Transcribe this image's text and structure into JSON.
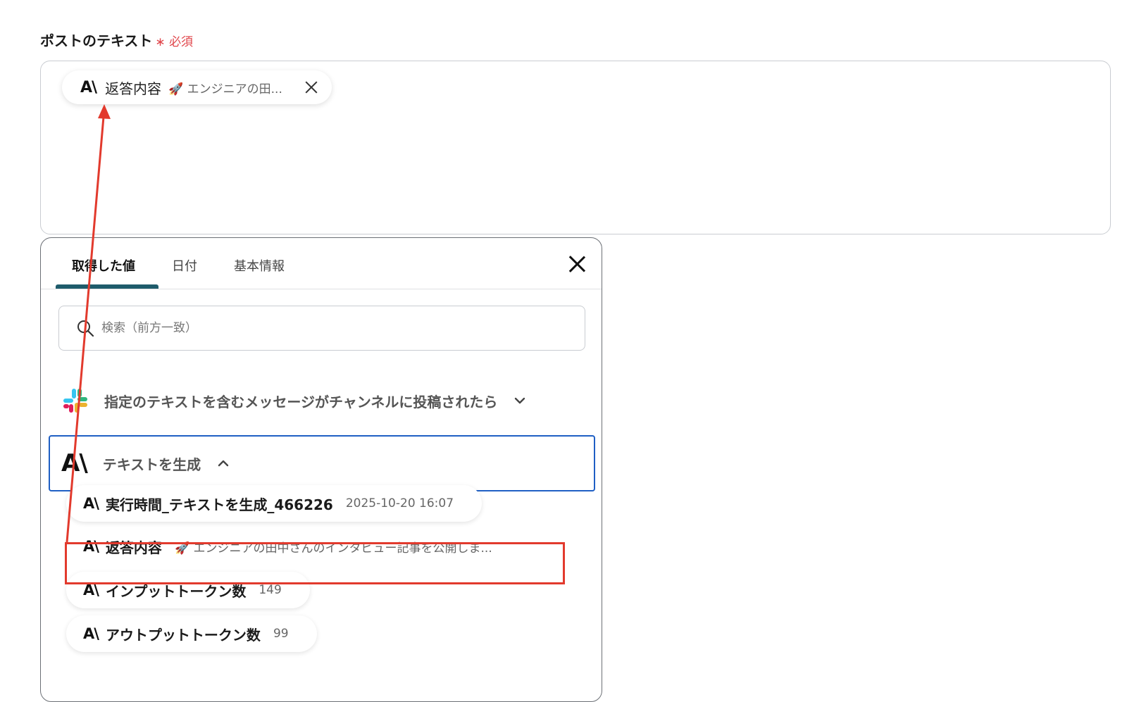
{
  "field": {
    "label": "ポストのテキスト",
    "required_mark": "∗",
    "required_text": "必須"
  },
  "chip": {
    "logo": "A\\",
    "label": "返答内容",
    "emoji": "🚀",
    "value": "エンジニアの田...",
    "close_icon": "close-icon"
  },
  "panel": {
    "tabs": [
      {
        "label": "取得した値",
        "active": true
      },
      {
        "label": "日付",
        "active": false
      },
      {
        "label": "基本情報",
        "active": false
      }
    ],
    "search_placeholder": "検索（前方一致）",
    "groups": [
      {
        "icon": "slack-icon",
        "title": "指定のテキストを含むメッセージがチャンネルに投稿されたら",
        "expanded": false
      },
      {
        "icon": "anthropic-icon",
        "title": "テキストを生成",
        "expanded": true
      }
    ],
    "items": [
      {
        "label": "実行時間_テキストを生成_466226",
        "value": "2025-10-20 16:07"
      },
      {
        "label": "返答内容",
        "value": "🚀 エンジニアの田中さんのインタビュー記事を公開しま..."
      },
      {
        "label": "インプットトークン数",
        "value": "149"
      },
      {
        "label": "アウトプットトークン数",
        "value": "99"
      }
    ]
  },
  "colors": {
    "accent_tab": "#1e5b6b",
    "selected_border": "#1f5fc4",
    "annotation": "#e23a2d",
    "required": "#e0454a"
  }
}
